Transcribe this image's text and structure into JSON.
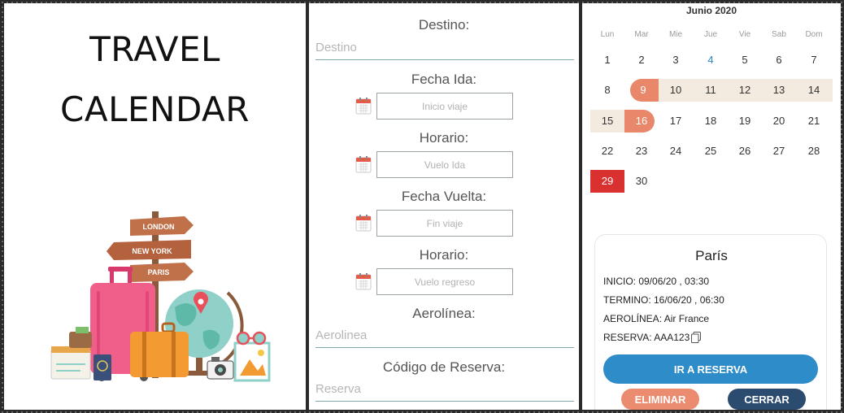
{
  "cover": {
    "title_line1": "TRAVEL",
    "title_line2": "CALENDAR",
    "signs": [
      "LONDON",
      "NEW YORK",
      "PARIS"
    ]
  },
  "form": {
    "destino_label": "Destino:",
    "destino_placeholder": "Destino",
    "fecha_ida_label": "Fecha Ida:",
    "fecha_ida_placeholder": "Inicio viaje",
    "horario_ida_label": "Horario:",
    "horario_ida_placeholder": "Vuelo Ida",
    "fecha_vuelta_label": "Fecha Vuelta:",
    "fecha_vuelta_placeholder": "Fin viaje",
    "horario_vuelta_label": "Horario:",
    "horario_vuelta_placeholder": "Vuelo regreso",
    "aerolinea_label": "Aerolínea:",
    "aerolinea_placeholder": "Aerolinea",
    "reserva_label": "Código de Reserva:",
    "reserva_placeholder": "Reserva"
  },
  "calendar": {
    "month": "Junio 2020",
    "weekdays": [
      "Lun",
      "Mar",
      "Mie",
      "Jue",
      "Vie",
      "Sab",
      "Dom"
    ],
    "weeks": [
      [
        "1",
        "2",
        "3",
        "4",
        "5",
        "6",
        "7"
      ],
      [
        "8",
        "9",
        "10",
        "11",
        "12",
        "13",
        "14"
      ],
      [
        "15",
        "16",
        "17",
        "18",
        "19",
        "20",
        "21"
      ],
      [
        "22",
        "23",
        "24",
        "25",
        "26",
        "27",
        "28"
      ],
      [
        "29",
        "30",
        "",
        "",
        "",
        "",
        ""
      ]
    ],
    "today": "4",
    "selected_start": "9",
    "selected_end": "16",
    "highlight_day": "29",
    "colors": {
      "selection": "#e88769",
      "range": "#f3ebdf",
      "highlight": "#d93030",
      "today": "#2e86c1"
    }
  },
  "trip": {
    "city": "París",
    "inicio": "INICIO: 09/06/20 , 03:30",
    "termino": "TERMINO: 16/06/20 , 06:30",
    "aerolinea": "AEROLÍNEA: Air France",
    "reserva": "RESERVA: AAA123",
    "ir_reserva_label": "IR A RESERVA",
    "eliminar_label": "ELIMINAR",
    "cerrar_label": "CERRAR",
    "colors": {
      "primary": "#2e8cc8",
      "delete": "#eb8b6f",
      "close": "#2b4b6f"
    }
  }
}
